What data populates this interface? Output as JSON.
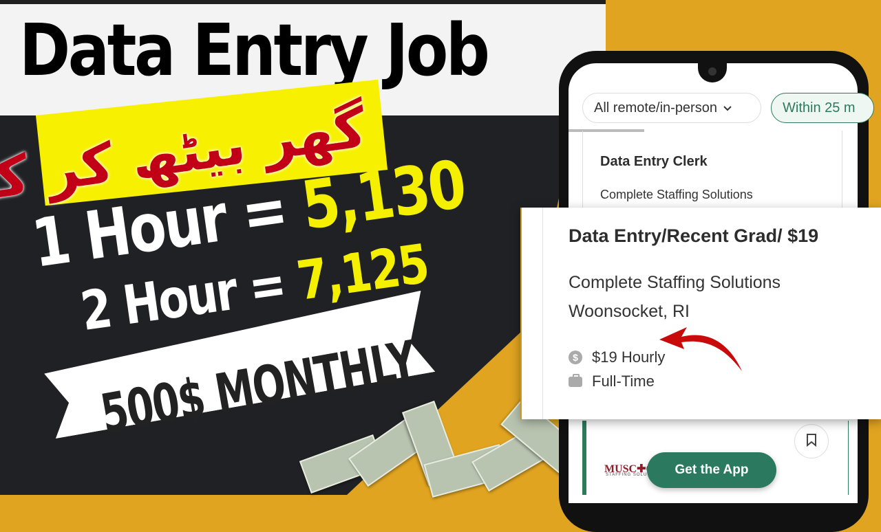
{
  "headline": {
    "title": "Data Entry Job"
  },
  "urdu_banner": {
    "text": "گھر بیٹھ کر کام کرو"
  },
  "earnings": {
    "line1_label": "1 Hour = ",
    "line1_value": "5,130",
    "line2_label": "2 Hour = ",
    "line2_value": "7,125"
  },
  "monthly_banner": {
    "text": "500$ MONTHLY"
  },
  "phone": {
    "filters": [
      {
        "label": "All remote/in-person",
        "icon": "chevron-down-icon"
      },
      {
        "label": "Within 25 m"
      }
    ],
    "list_card": {
      "title": "Data Entry Clerk",
      "company": "Complete Staffing Solutions"
    },
    "bottom_card": {
      "logo": "MUSC✚GE",
      "logo_sub": "STAFFING SOLUTIONS",
      "bookmark_icon": "bookmark-icon"
    },
    "cta": {
      "label": "Get the App"
    }
  },
  "job_popup": {
    "title": "Data Entry/Recent Grad/ $19",
    "company": "Complete Staffing Solutions",
    "location": "Woonsocket, RI",
    "pay": {
      "icon": "dollar-circle-icon",
      "glyph": "$",
      "text": "$19 Hourly"
    },
    "type": {
      "icon": "briefcase-icon",
      "text": "Full-Time"
    }
  },
  "colors": {
    "accent_yellow": "#f5f000",
    "accent_orange": "#e0a421",
    "brand_green": "#2b7a5f",
    "urdu_red": "#c10017"
  }
}
